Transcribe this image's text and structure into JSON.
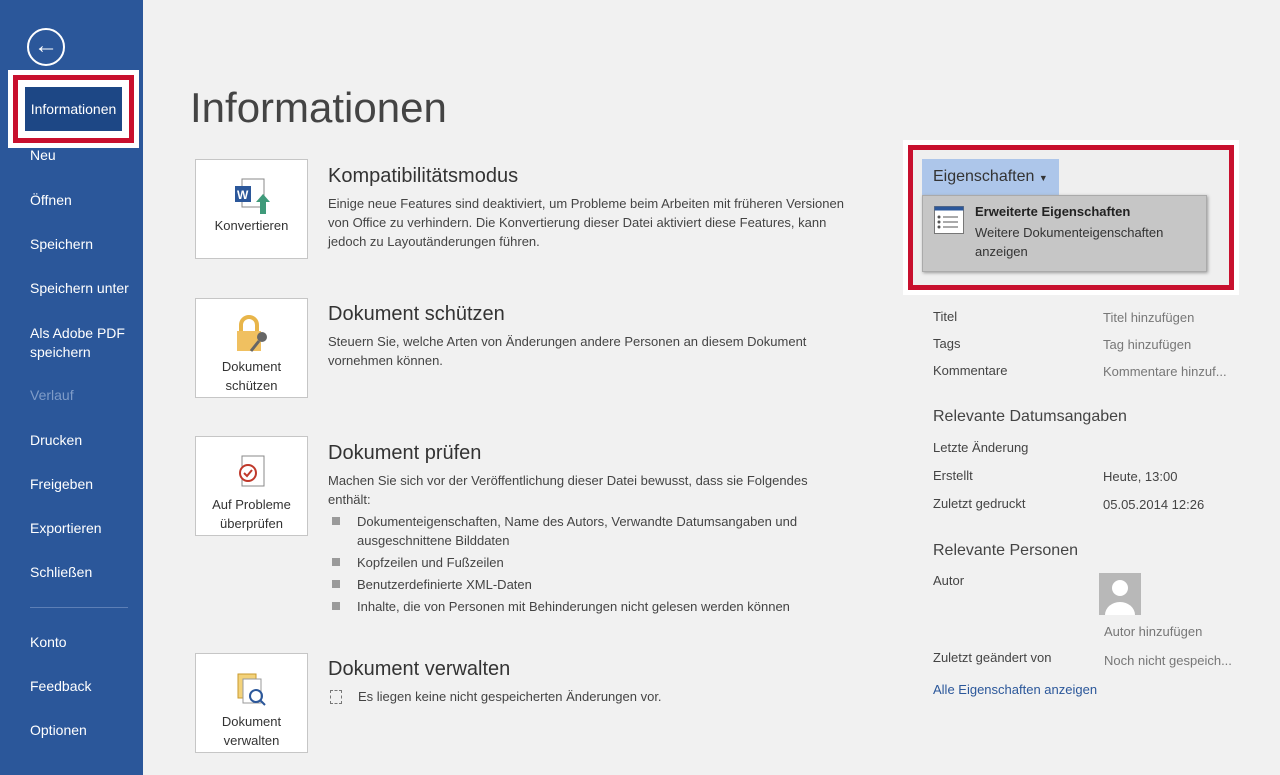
{
  "sidebar": {
    "back_icon": "arrow-left-circle-icon",
    "selected": "Informationen",
    "items": [
      {
        "label": "Neu"
      },
      {
        "label": "Öffnen"
      },
      {
        "label": "Speichern"
      },
      {
        "label": "Speichern unter"
      },
      {
        "label": "Als Adobe PDF speichern"
      },
      {
        "label": "Verlauf",
        "disabled": true
      },
      {
        "label": "Drucken"
      },
      {
        "label": "Freigeben"
      },
      {
        "label": "Exportieren"
      },
      {
        "label": "Schließen"
      },
      {
        "label": "Konto"
      },
      {
        "label": "Feedback"
      },
      {
        "label": "Optionen"
      }
    ]
  },
  "main": {
    "title": "Informationen",
    "sections": [
      {
        "button": "Konvertieren",
        "icon": "word-convert-icon",
        "heading": "Kompatibilitätsmodus",
        "text": "Einige neue Features sind deaktiviert, um Probleme beim Arbeiten mit früheren Versionen von Office zu verhindern. Die Konvertierung dieser Datei aktiviert diese Features, kann jedoch zu Layoutänderungen führen."
      },
      {
        "button": "Dokument schützen",
        "icon": "lock-key-icon",
        "heading": "Dokument schützen",
        "text": "Steuern Sie, welche Arten von Änderungen andere Personen an diesem Dokument vornehmen können."
      },
      {
        "button": "Auf Probleme überprüfen",
        "icon": "inspect-document-icon",
        "heading": "Dokument prüfen",
        "text": "Machen Sie sich vor der Veröffentlichung dieser Datei bewusst, dass sie Folgendes enthält:",
        "bullets": [
          "Dokumenteigenschaften, Name des Autors, Verwandte Datumsangaben und ausgeschnittene Bilddaten",
          "Kopfzeilen und Fußzeilen",
          "Benutzerdefinierte XML-Daten",
          "Inhalte, die von Personen mit Behinderungen nicht gelesen werden können"
        ]
      },
      {
        "button": "Dokument verwalten",
        "icon": "manage-document-icon",
        "heading": "Dokument verwalten",
        "text": "Es liegen keine nicht gespeicherten Änderungen vor."
      }
    ]
  },
  "properties": {
    "button": "Eigenschaften",
    "menu": {
      "title": "Erweiterte Eigenschaften",
      "desc": "Weitere Dokumenteigenschaften anzeigen"
    },
    "rows": [
      {
        "label": "Titel",
        "value": "Titel hinzufügen"
      },
      {
        "label": "Tags",
        "value": "Tag hinzufügen"
      },
      {
        "label": "Kommentare",
        "value": "Kommentare hinzuf..."
      }
    ],
    "dates_heading": "Relevante Datumsangaben",
    "dates": [
      {
        "label": "Letzte Änderung",
        "value": ""
      },
      {
        "label": "Erstellt",
        "value": "Heute, 13:00"
      },
      {
        "label": "Zuletzt gedruckt",
        "value": "05.05.2014 12:26"
      }
    ],
    "people_heading": "Relevante Personen",
    "author_label": "Autor",
    "add_author": "Autor hinzufügen",
    "modified_by_label": "Zuletzt geändert von",
    "modified_by_value": "Noch nicht gespeich...",
    "all_link": "Alle Eigenschaften anzeigen"
  },
  "colors": {
    "sidebar": "#2b579a",
    "selected": "#1d4785",
    "highlight": "#c8102e",
    "link": "#2b579a"
  }
}
